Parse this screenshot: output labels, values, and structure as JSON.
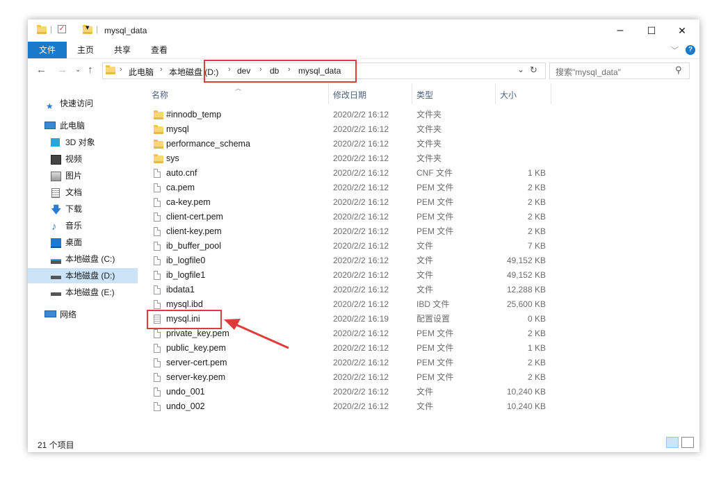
{
  "window": {
    "title": "mysql_data",
    "controls": {
      "minimize": "–",
      "maximize": "☐",
      "close": "✕"
    }
  },
  "ribbon": {
    "tabs": [
      "文件",
      "主页",
      "共享",
      "查看"
    ],
    "help": "?"
  },
  "address": {
    "breadcrumbs": [
      "此电脑",
      "本地磁盘 (D:)",
      "dev",
      "db",
      "mysql_data"
    ],
    "search_placeholder": "搜索\"mysql_data\""
  },
  "nav": {
    "items": [
      {
        "label": "快速访问",
        "icon": "star-icon"
      },
      {
        "label": "此电脑",
        "icon": "computer-icon"
      },
      {
        "label": "3D 对象",
        "icon": "cube-icon"
      },
      {
        "label": "视频",
        "icon": "video-icon"
      },
      {
        "label": "图片",
        "icon": "picture-icon"
      },
      {
        "label": "文档",
        "icon": "document-icon"
      },
      {
        "label": "下载",
        "icon": "download-icon"
      },
      {
        "label": "音乐",
        "icon": "music-icon"
      },
      {
        "label": "桌面",
        "icon": "desktop-icon"
      },
      {
        "label": "本地磁盘 (C:)",
        "icon": "drive-icon"
      },
      {
        "label": "本地磁盘 (D:)",
        "icon": "drive-icon",
        "selected": true
      },
      {
        "label": "本地磁盘 (E:)",
        "icon": "drive-icon"
      },
      {
        "label": "网络",
        "icon": "network-icon"
      }
    ]
  },
  "columns": [
    "名称",
    "修改日期",
    "类型",
    "大小"
  ],
  "files": [
    {
      "name": "#innodb_temp",
      "date": "2020/2/2 16:12",
      "type": "文件夹",
      "size": "",
      "kind": "folder"
    },
    {
      "name": "mysql",
      "date": "2020/2/2 16:12",
      "type": "文件夹",
      "size": "",
      "kind": "folder"
    },
    {
      "name": "performance_schema",
      "date": "2020/2/2 16:12",
      "type": "文件夹",
      "size": "",
      "kind": "folder"
    },
    {
      "name": "sys",
      "date": "2020/2/2 16:12",
      "type": "文件夹",
      "size": "",
      "kind": "folder"
    },
    {
      "name": "auto.cnf",
      "date": "2020/2/2 16:12",
      "type": "CNF 文件",
      "size": "1 KB",
      "kind": "file"
    },
    {
      "name": "ca.pem",
      "date": "2020/2/2 16:12",
      "type": "PEM 文件",
      "size": "2 KB",
      "kind": "file"
    },
    {
      "name": "ca-key.pem",
      "date": "2020/2/2 16:12",
      "type": "PEM 文件",
      "size": "2 KB",
      "kind": "file"
    },
    {
      "name": "client-cert.pem",
      "date": "2020/2/2 16:12",
      "type": "PEM 文件",
      "size": "2 KB",
      "kind": "file"
    },
    {
      "name": "client-key.pem",
      "date": "2020/2/2 16:12",
      "type": "PEM 文件",
      "size": "2 KB",
      "kind": "file"
    },
    {
      "name": "ib_buffer_pool",
      "date": "2020/2/2 16:12",
      "type": "文件",
      "size": "7 KB",
      "kind": "file"
    },
    {
      "name": "ib_logfile0",
      "date": "2020/2/2 16:12",
      "type": "文件",
      "size": "49,152 KB",
      "kind": "file"
    },
    {
      "name": "ib_logfile1",
      "date": "2020/2/2 16:12",
      "type": "文件",
      "size": "49,152 KB",
      "kind": "file"
    },
    {
      "name": "ibdata1",
      "date": "2020/2/2 16:12",
      "type": "文件",
      "size": "12,288 KB",
      "kind": "file"
    },
    {
      "name": "mysql.ibd",
      "date": "2020/2/2 16:12",
      "type": "IBD 文件",
      "size": "25,600 KB",
      "kind": "file"
    },
    {
      "name": "mysql.ini",
      "date": "2020/2/2 16:19",
      "type": "配置设置",
      "size": "0 KB",
      "kind": "ini"
    },
    {
      "name": "private_key.pem",
      "date": "2020/2/2 16:12",
      "type": "PEM 文件",
      "size": "2 KB",
      "kind": "file"
    },
    {
      "name": "public_key.pem",
      "date": "2020/2/2 16:12",
      "type": "PEM 文件",
      "size": "1 KB",
      "kind": "file"
    },
    {
      "name": "server-cert.pem",
      "date": "2020/2/2 16:12",
      "type": "PEM 文件",
      "size": "2 KB",
      "kind": "file"
    },
    {
      "name": "server-key.pem",
      "date": "2020/2/2 16:12",
      "type": "PEM 文件",
      "size": "2 KB",
      "kind": "file"
    },
    {
      "name": "undo_001",
      "date": "2020/2/2 16:12",
      "type": "文件",
      "size": "10,240 KB",
      "kind": "file"
    },
    {
      "name": "undo_002",
      "date": "2020/2/2 16:12",
      "type": "文件",
      "size": "10,240 KB",
      "kind": "file"
    }
  ],
  "status": {
    "count": "21 个项目"
  },
  "colors": {
    "accent": "#1979ca",
    "annotation": "#e03a3a",
    "selected": "#cce4f7"
  }
}
